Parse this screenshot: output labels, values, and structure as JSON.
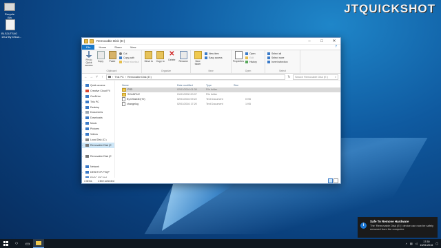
{
  "desktop": {
    "recycle_label": "Recycle Bin",
    "file_label": "BLS2UTS4G 19L2 By DSad...",
    "watermark": "JTQUICKSHOT"
  },
  "window": {
    "title": "Removable Disk (E:)",
    "tabs": [
      "File",
      "Home",
      "Share",
      "View"
    ],
    "help": "?",
    "ribbon": {
      "clipboard": {
        "label": "Clipboard",
        "pin": "Pin to Quick access",
        "copy": "Copy",
        "paste": "Paste",
        "cut": "Cut",
        "copy_path": "Copy path",
        "paste_shortcut": "Paste shortcut"
      },
      "organize": {
        "label": "Organize",
        "move_to": "Move to",
        "copy_to": "Copy to",
        "delete": "Delete",
        "rename": "Rename"
      },
      "new": {
        "label": "New",
        "new_folder": "New folder",
        "new_item": "New item",
        "easy_access": "Easy access"
      },
      "open": {
        "label": "Open",
        "properties": "Properties",
        "open": "Open",
        "edit": "Edit",
        "history": "History"
      },
      "select": {
        "label": "Select",
        "select_all": "Select all",
        "select_none": "Select none",
        "invert": "Invert selection"
      }
    },
    "address": {
      "path": [
        "This PC",
        "Removable Disk (E:)"
      ],
      "search_placeholder": "Search Removable Disk (E:)"
    },
    "navpane": [
      {
        "label": "Quick access",
        "icon": "star-icon",
        "color": "#3a7ac8"
      },
      {
        "label": "Creative Cloud Fil",
        "icon": "cloud-icon",
        "color": "#d8442f"
      },
      {
        "label": "OneDrive",
        "icon": "onedrive-icon",
        "color": "#3a7ac8"
      },
      {
        "label": "This PC",
        "icon": "pc-icon",
        "color": "#3a7ac8"
      },
      {
        "label": "Desktop",
        "icon": "desktop-icon",
        "color": "#3a7ac8"
      },
      {
        "label": "Documents",
        "icon": "documents-icon",
        "color": "#9aa7b5"
      },
      {
        "label": "Downloads",
        "icon": "downloads-icon",
        "color": "#3a7ac8"
      },
      {
        "label": "Music",
        "icon": "music-icon",
        "color": "#3a7ac8"
      },
      {
        "label": "Pictures",
        "icon": "pictures-icon",
        "color": "#3a7ac8"
      },
      {
        "label": "Videos",
        "icon": "videos-icon",
        "color": "#3a7ac8"
      },
      {
        "label": "Local Disk (C:)",
        "icon": "disk-icon",
        "color": "#888888"
      },
      {
        "label": "Removable Disk (E",
        "icon": "usb-icon",
        "color": "#777777"
      },
      {
        "label": "",
        "icon": "",
        "color": ""
      },
      {
        "label": "Removable Disk (E",
        "icon": "usb-icon",
        "color": "#777777"
      },
      {
        "label": "",
        "icon": "",
        "color": ""
      },
      {
        "label": "Network",
        "icon": "network-icon",
        "color": "#3a7ac8"
      },
      {
        "label": "DESKTOP-P9QP",
        "icon": "computer-icon",
        "color": "#3a7ac8"
      },
      {
        "label": "RASC-05C4A4",
        "icon": "computer-icon",
        "color": "#3a7ac8"
      }
    ],
    "columns": [
      "Name",
      "Date modified",
      "Type",
      "Size"
    ],
    "files": [
      {
        "name": "PS3",
        "date": "02/01/2016 01:38",
        "type": "File folder",
        "size": "",
        "kind": "folder"
      },
      {
        "name": "SCANFILE",
        "date": "01/01/2000 00:07",
        "type": "File folder",
        "size": "",
        "kind": "folder"
      },
      {
        "name": "By DSaD3D(T2)",
        "date": "02/01/2016 09:22",
        "type": "Text Document",
        "size": "0 KB",
        "kind": "doc"
      },
      {
        "name": "changelog",
        "date": "02/01/2016 17:20",
        "type": "Text Document",
        "size": "1 KB",
        "kind": "doc"
      }
    ],
    "status": {
      "items": "4 items",
      "selected": "1 item selected"
    }
  },
  "notification": {
    "title": "Safe To Remove Hardware",
    "body": "The 'Removable Disk (E:)' device can now be safely removed from the computer."
  },
  "taskbar": {
    "time": "17:30",
    "date": "15/01/2016"
  }
}
